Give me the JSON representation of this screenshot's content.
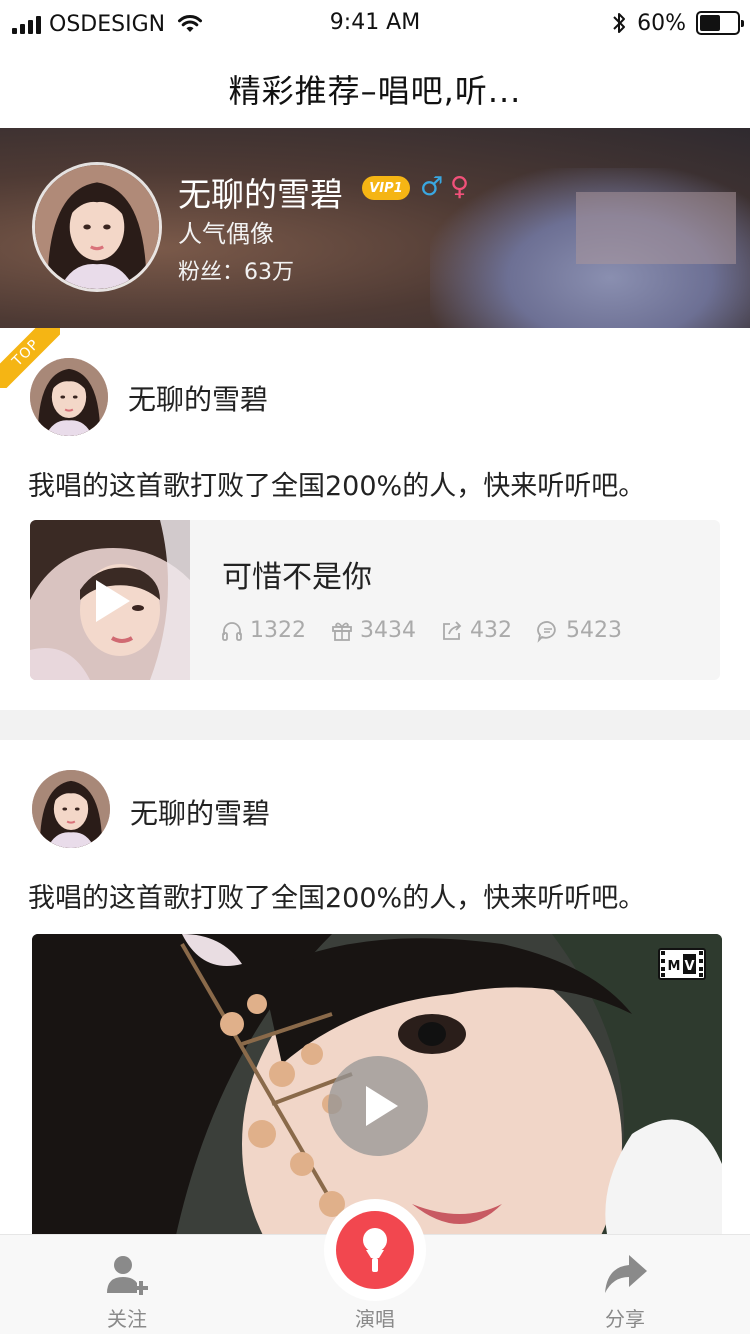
{
  "status_bar": {
    "carrier": "OSDESIGN",
    "time": "9:41 AM",
    "battery_percent": "60%",
    "battery_level": 0.6
  },
  "header": {
    "title": "精彩推荐–唱吧,听..."
  },
  "profile": {
    "name": "无聊的雪碧",
    "vip_label": "VIP1",
    "male_symbol": "♂",
    "female_symbol": "♀",
    "role": "人气偶像",
    "fans": "粉丝：63万"
  },
  "posts": [
    {
      "top_label": "TOP",
      "user": "无聊的雪碧",
      "text": "我唱的这首歌打败了全国200%的人，快来听听吧。",
      "song": {
        "title": "可惜不是你",
        "listens": "1322",
        "gifts": "3434",
        "shares": "432",
        "comments": "5423"
      }
    },
    {
      "user": "无聊的雪碧",
      "text": "我唱的这首歌打败了全国200%的人，快来听听吧。",
      "mv_badge": "MV"
    }
  ],
  "tabbar": {
    "follow": "关注",
    "sing": "演唱",
    "share": "分享"
  },
  "colors": {
    "accent": "#f2474f",
    "vip": "#f5b514",
    "male": "#3aa7e0",
    "female": "#f2517a"
  }
}
